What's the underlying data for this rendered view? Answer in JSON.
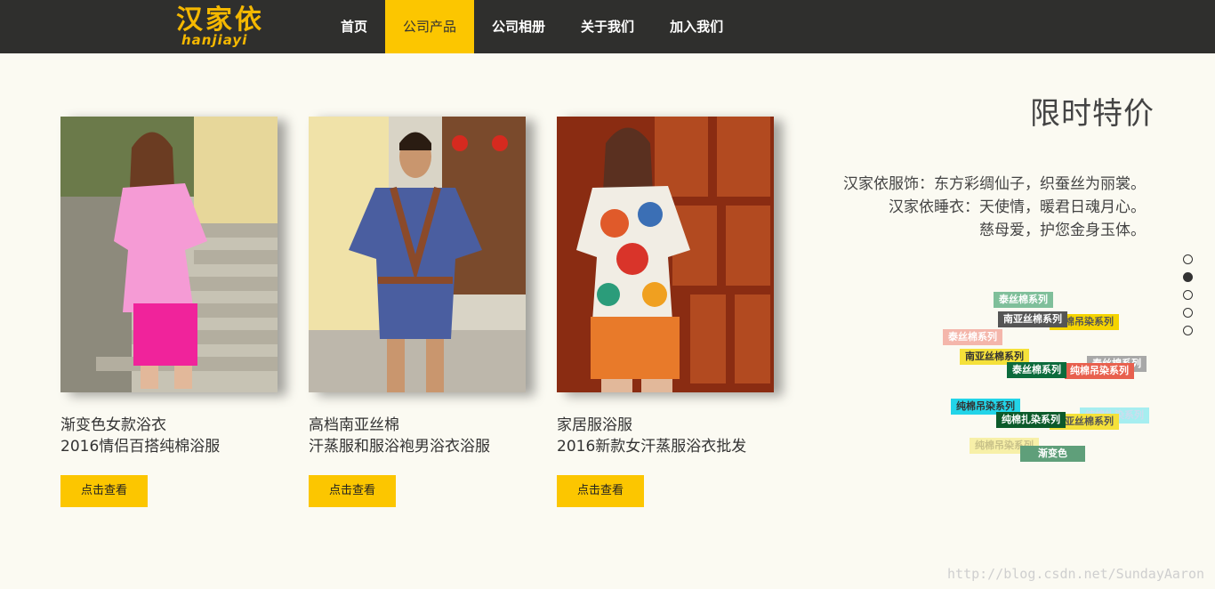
{
  "brand": {
    "name_cn": "汉家依",
    "name_en": "hanjiayi",
    "color": "#f5b800"
  },
  "nav": {
    "items": [
      {
        "label": "首页"
      },
      {
        "label": "公司产品"
      },
      {
        "label": "公司相册"
      },
      {
        "label": "关于我们"
      },
      {
        "label": "加入我们"
      }
    ],
    "active_label": "公司产品"
  },
  "products": [
    {
      "line1": "渐变色女款浴衣",
      "line2": "2016情侣百搭纯棉浴服",
      "button": "点击查看"
    },
    {
      "line1": "高档南亚丝棉",
      "line2": "汗蒸服和服浴袍男浴衣浴服",
      "button": "点击查看"
    },
    {
      "line1": "家居服浴服",
      "line2": "2016新款女汗蒸服浴衣批发",
      "button": "点击查看"
    }
  ],
  "special": {
    "title": "限时特价",
    "slogans": [
      "汉家依服饰：东方彩绸仙子，织蚕丝为丽裳。",
      "汉家依睡衣：天使情，暖君日魂月心。",
      "慈母爱，护您金身玉体。"
    ]
  },
  "slider": {
    "count": 5,
    "active_index": 1
  },
  "tags": [
    {
      "text": "泰丝棉系列",
      "color": "#7fbf9a"
    },
    {
      "text": "南亚丝棉系列",
      "color": "#555555"
    },
    {
      "text": "纯棉吊染系列",
      "color": "#f5d400"
    },
    {
      "text": "泰丝棉系列",
      "color": "#f4b6ab"
    },
    {
      "text": "南亚丝棉系列",
      "color": "#f5e13a"
    },
    {
      "text": "泰丝棉系列",
      "color": "#0c6b3c"
    },
    {
      "text": "纯棉吊染系列",
      "color": "#e8604e"
    },
    {
      "text": "泰丝棉系列",
      "color": "#a8a8a8"
    },
    {
      "text": "纯棉吊染系列",
      "color": "#22d4e8"
    },
    {
      "text": "纯棉扎染系列",
      "color": "#0c5a2a"
    },
    {
      "text": "纯棉扎染系列",
      "color": "#a6eef0"
    },
    {
      "text": "南亚丝棉系列",
      "color": "#f5e13a"
    },
    {
      "text": "纯棉吊染系列",
      "color": "#f7f0a8"
    },
    {
      "text": "渐变色",
      "color": "#5f9f7a"
    }
  ],
  "watermark": "http://blog.csdn.net/SundayAaron"
}
